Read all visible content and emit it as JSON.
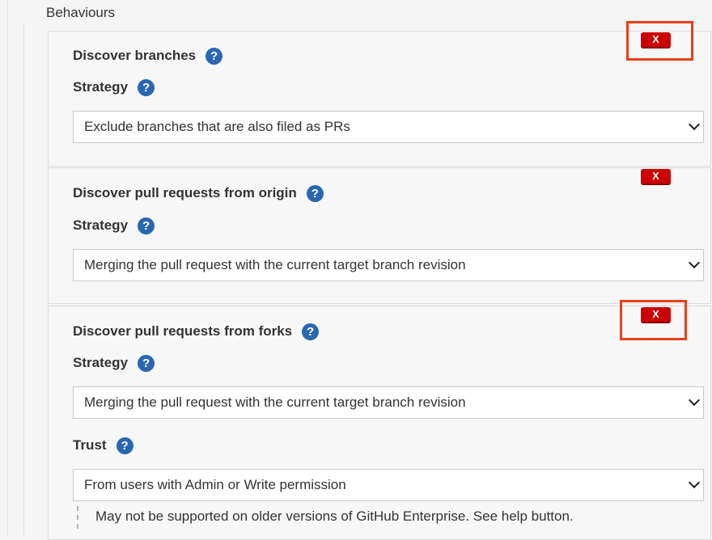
{
  "behaviours": {
    "title": "Behaviours",
    "delete_label": "X",
    "help_glyph": "?",
    "panels": [
      {
        "heading": "Discover branches",
        "fields": [
          {
            "label": "Strategy",
            "value": "Exclude branches that are also filed as PRs"
          }
        ]
      },
      {
        "heading": "Discover pull requests from origin",
        "fields": [
          {
            "label": "Strategy",
            "value": "Merging the pull request with the current target branch revision"
          }
        ]
      },
      {
        "heading": "Discover pull requests from forks",
        "fields": [
          {
            "label": "Strategy",
            "value": "Merging the pull request with the current target branch revision"
          },
          {
            "label": "Trust",
            "value": "From users with Admin or Write permission"
          }
        ],
        "note": "May not be supported on older versions of GitHub Enterprise. See help button."
      }
    ]
  },
  "colors": {
    "delete_button": "#cc0000",
    "help_icon": "#2a67b0",
    "highlight_box": "#e8401c"
  },
  "icons": {
    "help": "help-icon",
    "dropdown": "chevron-down-icon"
  }
}
